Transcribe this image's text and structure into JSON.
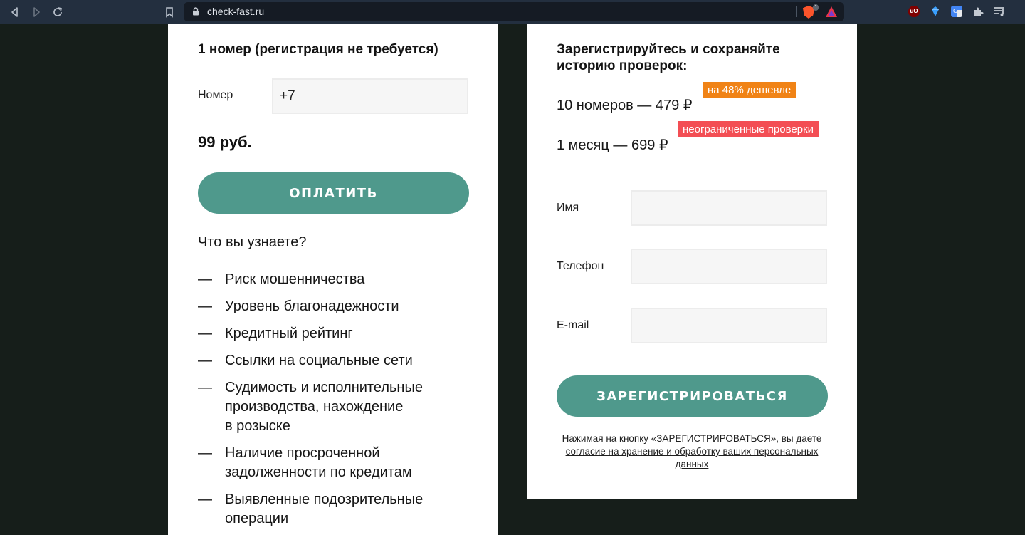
{
  "browser": {
    "url": "check-fast.ru",
    "icons": [
      "back-icon",
      "forward-icon",
      "reload-icon",
      "bookmark-icon",
      "lock-icon",
      "brave-shield-icon",
      "brave-rewards-icon",
      "ublock-icon",
      "gem-icon",
      "translate-icon",
      "extensions-icon",
      "playlist-icon"
    ],
    "shield_count": "1",
    "ublock_label": "uO"
  },
  "left_card": {
    "title": "1 номер (регистрация не требуется)",
    "number_label": "Номер",
    "number_value": "+7",
    "price": "99 руб.",
    "pay_button": "ОПЛАТИТЬ",
    "question": "Что вы узнаете?",
    "dash": "—",
    "features": [
      [
        "Риск мошенничества"
      ],
      [
        "Уровень благонадежности"
      ],
      [
        "Кредитный рейтинг"
      ],
      [
        "Ссылки на социальные сети"
      ],
      [
        "Судимость и исполнительные",
        "производства, нахождение",
        "в розыске"
      ],
      [
        "Наличие просроченной",
        "задолженности по кредитам"
      ],
      [
        "Выявленные подозрительные",
        "операции"
      ]
    ]
  },
  "right_card": {
    "title_line1": "Зарегистрируйтесь и сохраняйте",
    "title_line2": "историю проверок:",
    "tariff1": "10 номеров — 479 ₽",
    "tariff1_badge": "на 48% дешевле",
    "tariff2": "1 месяц — 699 ₽",
    "tariff2_badge": "неограниченные проверки",
    "name_label": "Имя",
    "phone_label": "Телефон",
    "email_label": "E-mail",
    "name_value": "",
    "phone_value": "",
    "email_value": "",
    "register_button": "ЗАРЕГИСТРИРОВАТЬСЯ",
    "consent_text": "Нажимая на кнопку «ЗАРЕГИСТРИРОВАТЬСЯ», вы даете",
    "consent_link_line1": "согласие на хранение и обработку ваших персональных",
    "consent_link_line2": "данных"
  },
  "colors": {
    "button": "#4f998c",
    "badge_orange": "#f08316",
    "badge_red": "#f34e54",
    "page_bg": "#161e1a",
    "chrome_bg": "#232f3f"
  }
}
